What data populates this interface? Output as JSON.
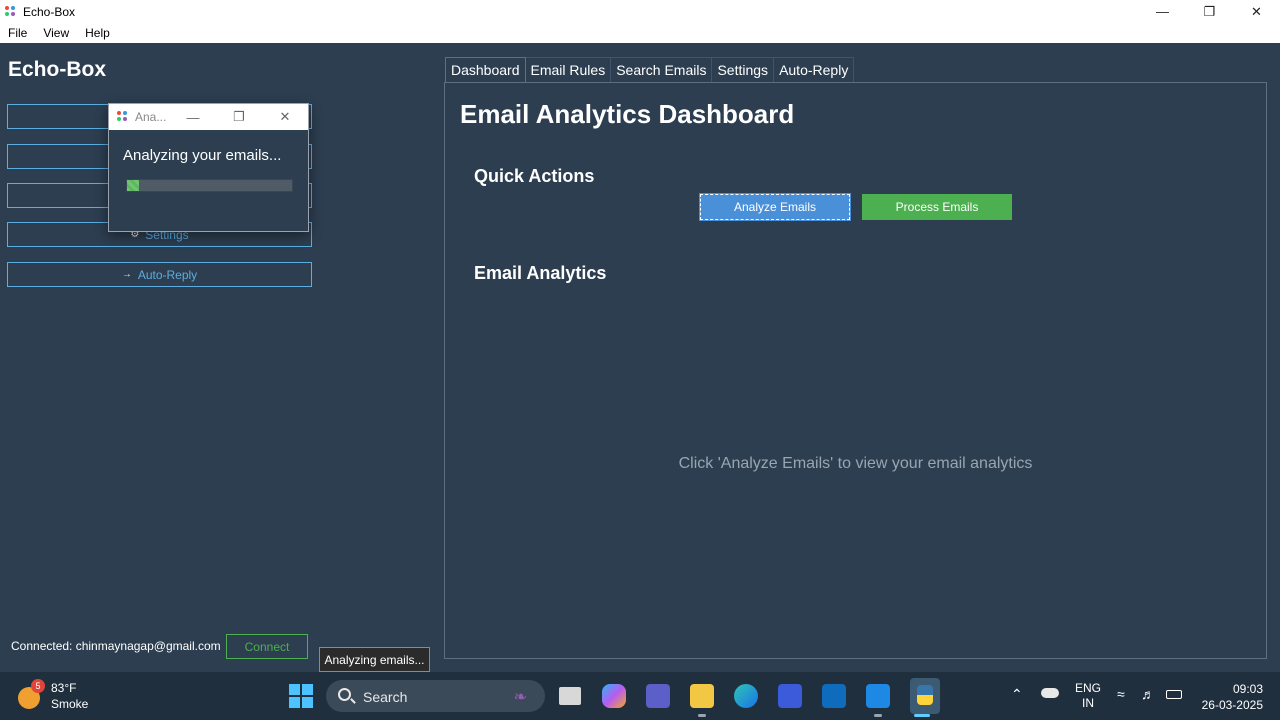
{
  "window": {
    "title": "Echo-Box"
  },
  "menu": [
    "File",
    "View",
    "Help"
  ],
  "sidebar": {
    "brand": "Echo-Box",
    "items": [
      {
        "label": "",
        "icon": "dashboard-icon"
      },
      {
        "label": "",
        "icon": "rules-icon"
      },
      {
        "label": "",
        "icon": "search-icon"
      },
      {
        "label": "Settings",
        "icon": "gear-icon"
      },
      {
        "label": "Auto-Reply",
        "icon": "arrow-icon"
      }
    ],
    "connection_status": "Connected: chinmaynagap@gmail.com",
    "connect_label": "Connect"
  },
  "tabs": [
    "Dashboard",
    "Email Rules",
    "Search Emails",
    "Settings",
    "Auto-Reply"
  ],
  "dashboard": {
    "title": "Email Analytics Dashboard",
    "quick_actions_title": "Quick Actions",
    "analyze_label": "Analyze Emails",
    "process_label": "Process Emails",
    "analytics_title": "Email Analytics",
    "hint": "Click 'Analyze Emails' to view your email analytics"
  },
  "dialog": {
    "title": "Ana...",
    "message": "Analyzing your emails...",
    "progress": 0.07
  },
  "status_tip": "Analyzing emails...",
  "taskbar": {
    "weather_badge": "5",
    "temperature": "83°F",
    "condition": "Smoke",
    "search_label": "Search",
    "lang_top": "ENG",
    "lang_bottom": "IN",
    "time": "09:03",
    "date": "26-03-2025"
  },
  "colors": {
    "background": "#2c3e50",
    "accent_blue": "#5dade2",
    "analyze_button": "#4a90d9",
    "process_button": "#4caf50"
  }
}
